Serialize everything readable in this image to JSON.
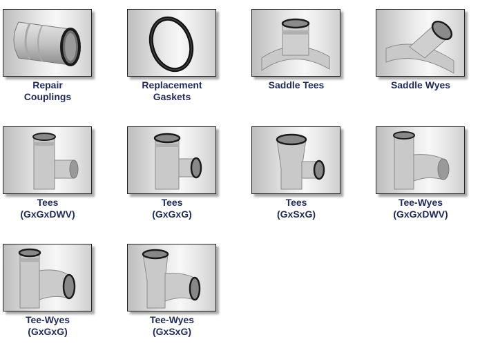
{
  "products": [
    {
      "id": "repair-couplings",
      "line1": "Repair",
      "line2": "Couplings"
    },
    {
      "id": "replacement-gaskets",
      "line1": "Replacement",
      "line2": "Gaskets"
    },
    {
      "id": "saddle-tees",
      "line1": "Saddle Tees",
      "line2": ""
    },
    {
      "id": "saddle-wyes",
      "line1": "Saddle Wyes",
      "line2": ""
    },
    {
      "id": "tees-gxgxdwv",
      "line1": "Tees",
      "line2": "(GxGxDWV)"
    },
    {
      "id": "tees-gxgxg",
      "line1": "Tees",
      "line2": "(GxGxG)"
    },
    {
      "id": "tees-gxsxg",
      "line1": "Tees",
      "line2": "(GxSxG)"
    },
    {
      "id": "tee-wyes-gxgxdwv",
      "line1": "Tee-Wyes",
      "line2": "(GxGxDWV)"
    },
    {
      "id": "tee-wyes-gxgxg",
      "line1": "Tee-Wyes",
      "line2": "(GxGxG)"
    },
    {
      "id": "tee-wyes-gxsxg",
      "line1": "Tee-Wyes",
      "line2": "(GxSxG)"
    }
  ],
  "icons": {
    "repair-couplings": "repair-coupling-icon",
    "replacement-gaskets": "gasket-ring-icon",
    "saddle-tees": "saddle-tee-icon",
    "saddle-wyes": "saddle-wye-icon",
    "tees": "tee-fitting-icon",
    "tee-wyes": "tee-wye-fitting-icon"
  },
  "colors": {
    "caption_text": "#1f2a5a",
    "pipe_gray": "#c8c8c8",
    "gasket_black": "#1a1a1a"
  }
}
